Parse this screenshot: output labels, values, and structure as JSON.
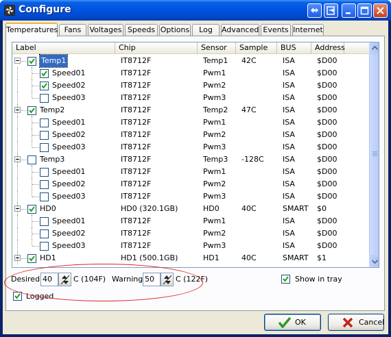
{
  "window": {
    "title": "Configure",
    "accent": "#0054e3",
    "title_buttons": [
      "swap-arrows-icon",
      "export-icon",
      "minimize-icon",
      "maximize-icon",
      "close-icon"
    ]
  },
  "tabs": [
    "Temperatures",
    "Fans",
    "Voltages",
    "Speeds",
    "Options",
    "Log",
    "Advanced",
    "Events",
    "Internet"
  ],
  "active_tab": "Temperatures",
  "columns": [
    "Label",
    "Chip",
    "Sensor",
    "Sample",
    "BUS",
    "Address"
  ],
  "rows": [
    {
      "level": 0,
      "checked": true,
      "selected": true,
      "label": "Temp1",
      "chip": "IT8712F",
      "sensor": "Temp1",
      "sample": "42C",
      "bus": "ISA",
      "address": "$D00"
    },
    {
      "level": 1,
      "checked": true,
      "selected": false,
      "label": "Speed01",
      "chip": "IT8712F",
      "sensor": "Pwm1",
      "sample": "",
      "bus": "ISA",
      "address": "$D00"
    },
    {
      "level": 1,
      "checked": true,
      "selected": false,
      "label": "Speed02",
      "chip": "IT8712F",
      "sensor": "Pwm2",
      "sample": "",
      "bus": "ISA",
      "address": "$D00"
    },
    {
      "level": 1,
      "checked": false,
      "selected": false,
      "label": "Speed03",
      "chip": "IT8712F",
      "sensor": "Pwm3",
      "sample": "",
      "bus": "ISA",
      "address": "$D00"
    },
    {
      "level": 0,
      "checked": true,
      "selected": false,
      "label": "Temp2",
      "chip": "IT8712F",
      "sensor": "Temp2",
      "sample": "47C",
      "bus": "ISA",
      "address": "$D00"
    },
    {
      "level": 1,
      "checked": false,
      "selected": false,
      "label": "Speed01",
      "chip": "IT8712F",
      "sensor": "Pwm1",
      "sample": "",
      "bus": "ISA",
      "address": "$D00"
    },
    {
      "level": 1,
      "checked": false,
      "selected": false,
      "label": "Speed02",
      "chip": "IT8712F",
      "sensor": "Pwm2",
      "sample": "",
      "bus": "ISA",
      "address": "$D00"
    },
    {
      "level": 1,
      "checked": false,
      "selected": false,
      "label": "Speed03",
      "chip": "IT8712F",
      "sensor": "Pwm3",
      "sample": "",
      "bus": "ISA",
      "address": "$D00"
    },
    {
      "level": 0,
      "checked": false,
      "selected": false,
      "label": "Temp3",
      "chip": "IT8712F",
      "sensor": "Temp3",
      "sample": "-128C",
      "bus": "ISA",
      "address": "$D00"
    },
    {
      "level": 1,
      "checked": false,
      "selected": false,
      "label": "Speed01",
      "chip": "IT8712F",
      "sensor": "Pwm1",
      "sample": "",
      "bus": "ISA",
      "address": "$D00"
    },
    {
      "level": 1,
      "checked": false,
      "selected": false,
      "label": "Speed02",
      "chip": "IT8712F",
      "sensor": "Pwm2",
      "sample": "",
      "bus": "ISA",
      "address": "$D00"
    },
    {
      "level": 1,
      "checked": false,
      "selected": false,
      "label": "Speed03",
      "chip": "IT8712F",
      "sensor": "Pwm3",
      "sample": "",
      "bus": "ISA",
      "address": "$D00"
    },
    {
      "level": 0,
      "checked": true,
      "selected": false,
      "label": "HD0",
      "chip": "HD0 (320.1GB)",
      "sensor": "HD0",
      "sample": "40C",
      "bus": "SMART",
      "address": "$0"
    },
    {
      "level": 1,
      "checked": false,
      "selected": false,
      "label": "Speed01",
      "chip": "IT8712F",
      "sensor": "Pwm1",
      "sample": "",
      "bus": "ISA",
      "address": "$D00"
    },
    {
      "level": 1,
      "checked": false,
      "selected": false,
      "label": "Speed02",
      "chip": "IT8712F",
      "sensor": "Pwm2",
      "sample": "",
      "bus": "ISA",
      "address": "$D00"
    },
    {
      "level": 1,
      "checked": false,
      "selected": false,
      "label": "Speed03",
      "chip": "IT8712F",
      "sensor": "Pwm3",
      "sample": "",
      "bus": "ISA",
      "address": "$D00"
    },
    {
      "level": 0,
      "checked": true,
      "selected": false,
      "label": "HD1",
      "chip": "HD1 (500.1GB)",
      "sensor": "HD1",
      "sample": "40C",
      "bus": "SMART",
      "address": "$1"
    }
  ],
  "settings": {
    "desired_label": "Desired",
    "desired_value": "40",
    "desired_unit": "C (104F)",
    "warning_label": "Warning",
    "warning_value": "50",
    "warning_unit": "C (122F)",
    "show_in_tray_label": "Show in tray",
    "show_in_tray_checked": true,
    "logged_label": "Logged",
    "logged_checked": true
  },
  "buttons": {
    "ok_label": "OK",
    "cancel_label": "Cancel"
  },
  "annotation_color": "#d22222"
}
